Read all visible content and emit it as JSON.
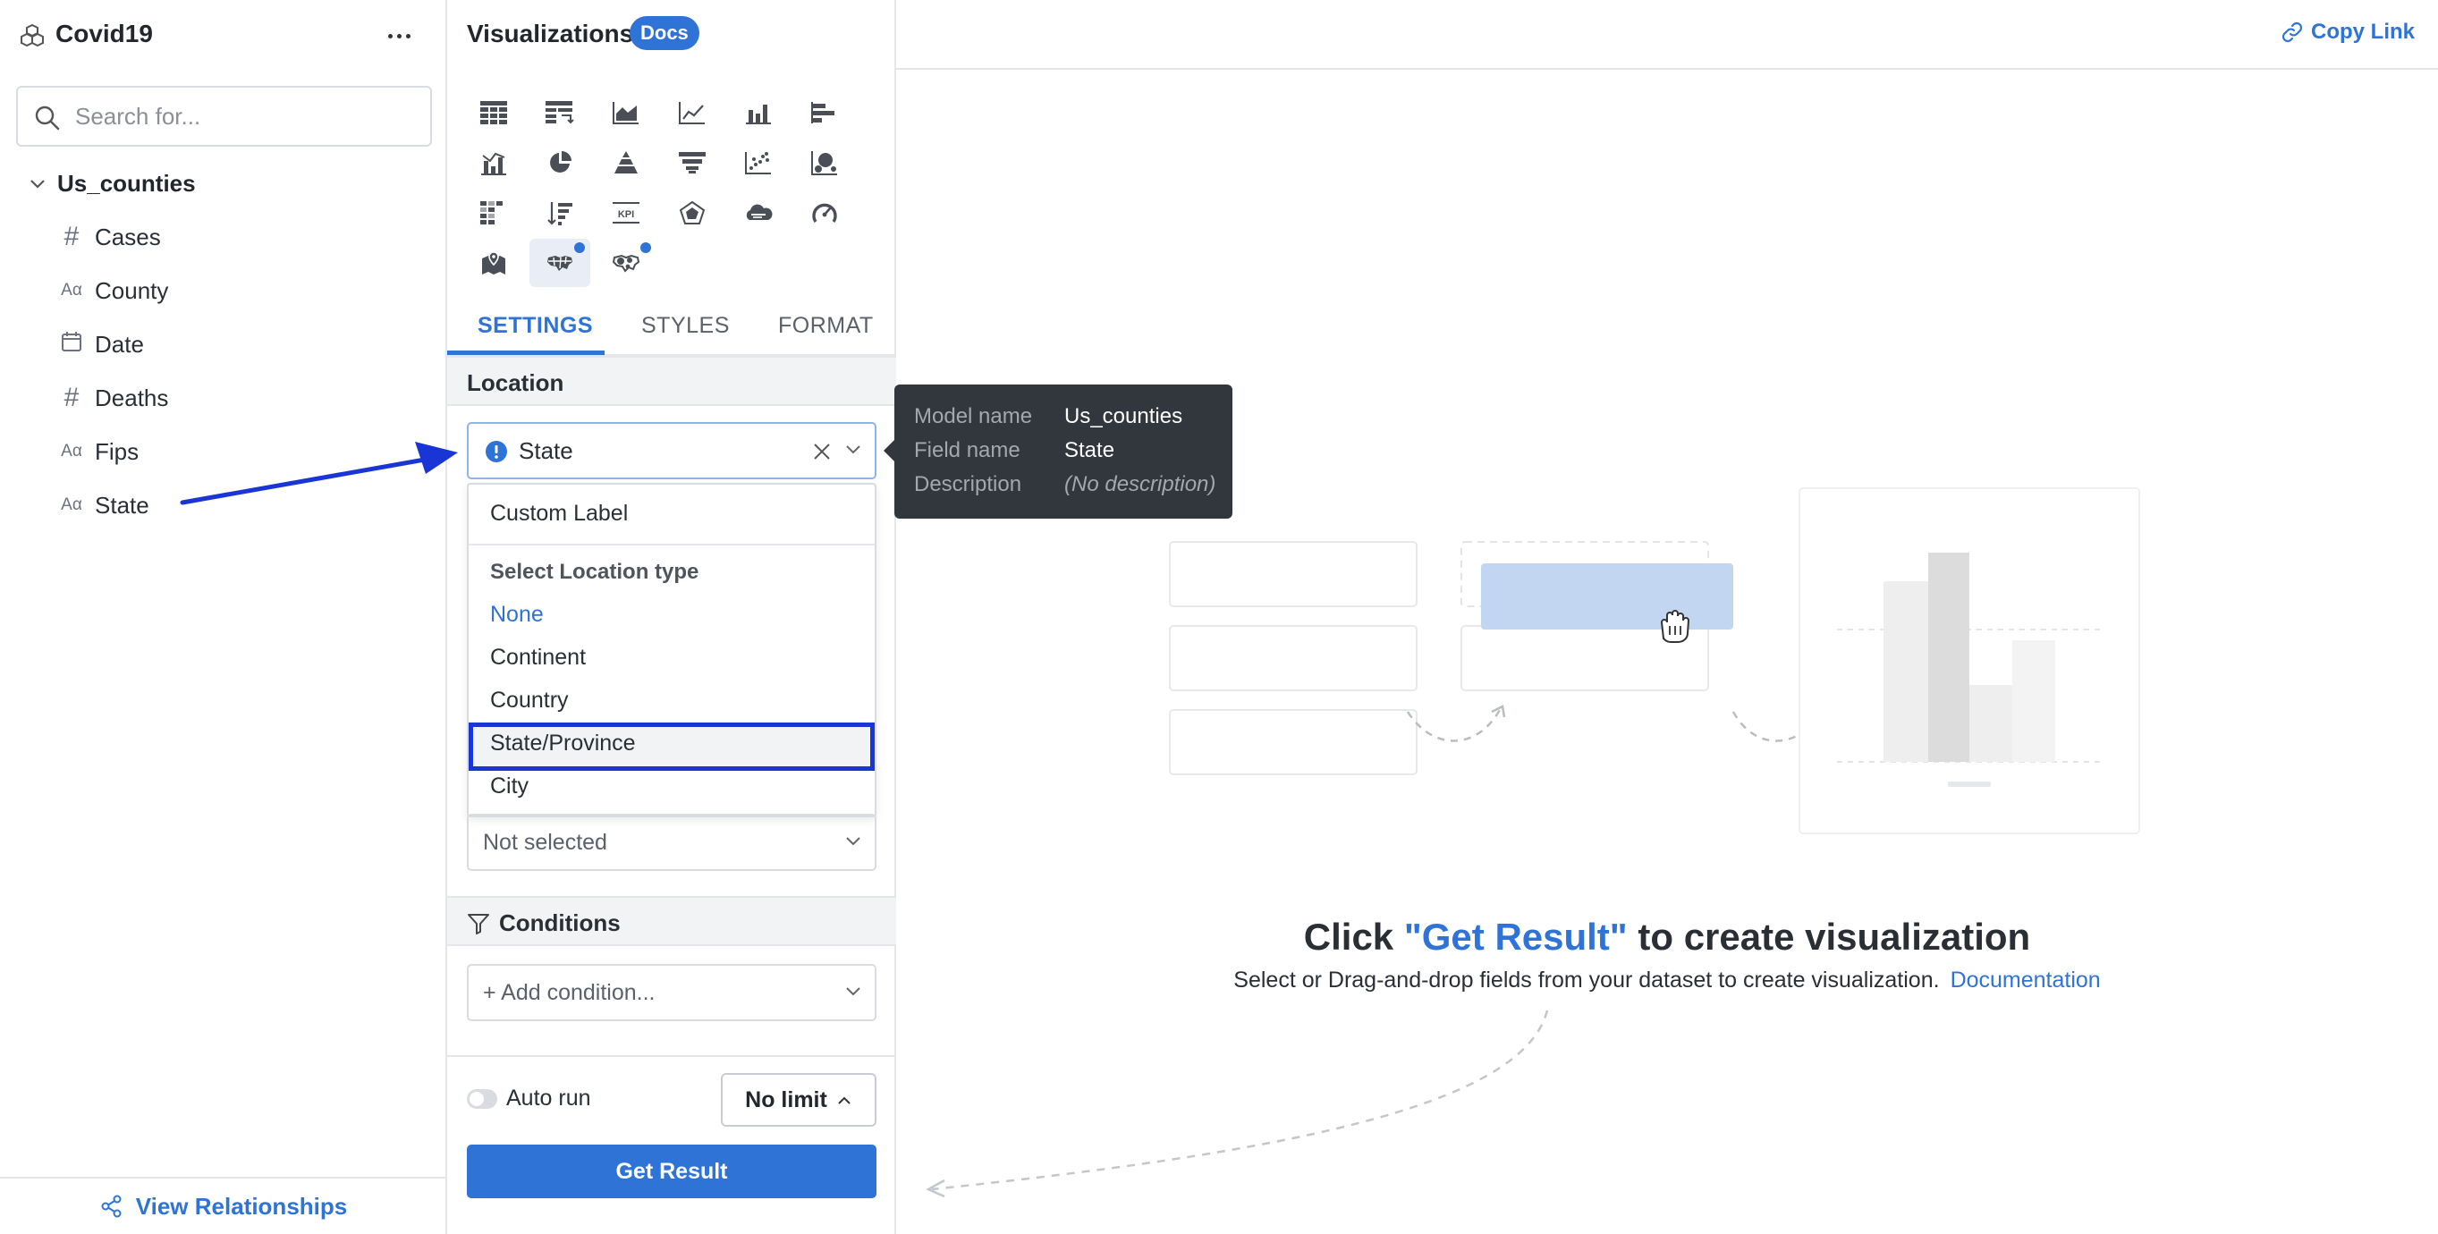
{
  "sidebar": {
    "title": "Covid19",
    "search_placeholder": "Search for...",
    "model": "Us_counties",
    "fields": [
      {
        "type": "number",
        "name": "Cases"
      },
      {
        "type": "text",
        "name": "County"
      },
      {
        "type": "date",
        "name": "Date"
      },
      {
        "type": "number",
        "name": "Deaths"
      },
      {
        "type": "text",
        "name": "Fips"
      },
      {
        "type": "text",
        "name": "State"
      }
    ],
    "footer_label": "View Relationships"
  },
  "panel": {
    "title": "Visualizations",
    "docs_badge": "Docs",
    "tabs": [
      "SETTINGS",
      "STYLES",
      "FORMAT"
    ],
    "active_tab": "SETTINGS",
    "location_section": "Location",
    "location_value": "State",
    "dropdown": {
      "custom_label": "Custom Label",
      "header": "Select Location type",
      "options": [
        "None",
        "Continent",
        "Country",
        "State/Province",
        "City"
      ],
      "selected": "None",
      "highlighted": "State/Province"
    },
    "not_selected": "Not selected",
    "conditions_section": "Conditions",
    "add_condition": "+ Add condition...",
    "auto_run_label": "Auto run",
    "limit_label": "No limit",
    "get_result": "Get Result"
  },
  "tooltip": {
    "rows": [
      {
        "key": "Model name",
        "value": "Us_counties"
      },
      {
        "key": "Field name",
        "value": "State"
      },
      {
        "key": "Description",
        "value": "(No description)"
      }
    ]
  },
  "main": {
    "copy_link": "Copy Link",
    "empty_title_pre": "Click ",
    "empty_title_hl": "\"Get Result\"",
    "empty_title_post": " to create visualization",
    "empty_sub": "Select or Drag-and-drop fields from your dataset to create visualization.",
    "doc_link": "Documentation"
  },
  "colors": {
    "accent": "#2f73d6",
    "highlight_border": "#1a35d6",
    "tooltip_bg": "#32363d"
  }
}
